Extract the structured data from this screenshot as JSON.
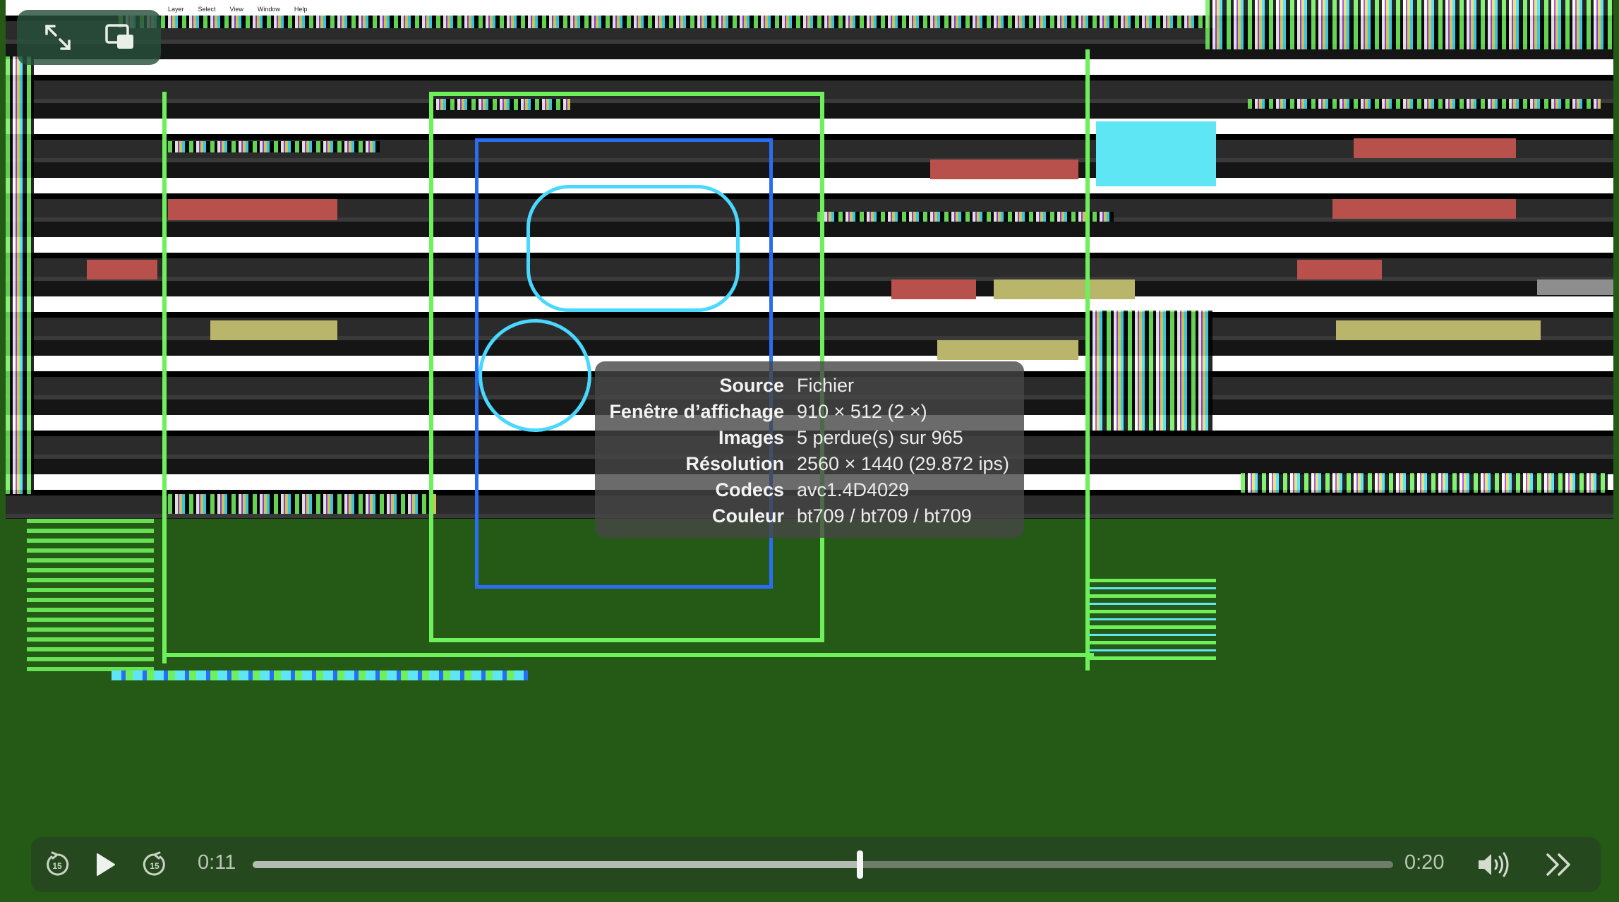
{
  "window": {
    "menu_items": [
      "Layer",
      "Select",
      "View",
      "Window",
      "Help"
    ]
  },
  "top_controls": {
    "fullscreen_icon": "expand-arrows-icon",
    "pip_icon": "picture-in-picture-icon"
  },
  "media_info": {
    "rows": [
      {
        "label": "Source",
        "value": "Fichier"
      },
      {
        "label": "Fenêtre d’affichage",
        "value": "910 × 512 (2 ×)"
      },
      {
        "label": "Images",
        "value": "5 perdue(s) sur 965"
      },
      {
        "label": "Résolution",
        "value": "2560 × 1440 (29.872 ips)"
      },
      {
        "label": "Codecs",
        "value": "avc1.4D4029"
      },
      {
        "label": "Couleur",
        "value": "bt709 / bt709 / bt709"
      }
    ]
  },
  "transport": {
    "current_time": "0:11",
    "duration": "0:20",
    "progress": 0.532,
    "skip_back_icon": "skip-back-15-icon",
    "play_icon": "play-icon",
    "skip_forward_icon": "skip-forward-15-icon",
    "volume_icon": "volume-icon",
    "speed_icon": "fast-forward-chevrons-icon"
  },
  "colors": {
    "video_background": "#245a16",
    "overlay_background": "#464646",
    "thumb": "#f5f5f5"
  }
}
